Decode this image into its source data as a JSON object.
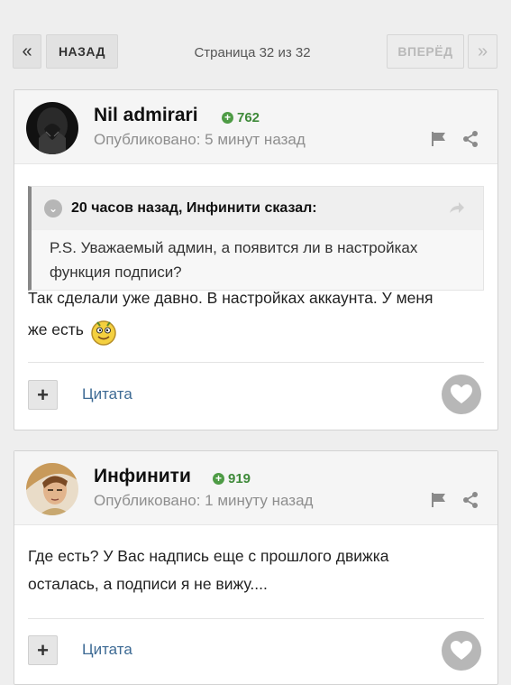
{
  "pagination": {
    "prev_arrow": "«",
    "prev_label": "НАЗАД",
    "page_info": "Страница 32 из 32",
    "next_label": "ВПЕРЁД",
    "next_arrow": "»"
  },
  "posts": [
    {
      "author": "Nil admirari",
      "reputation": "762",
      "posted": "Опубликовано: 5 минут назад",
      "quote": {
        "header": "20 часов назад, Инфинити сказал:",
        "text": "P.S. Уважаемый админ, а появится ли в настройках функция подписи?"
      },
      "text_line1": "Так сделали уже давно. В настройках аккаунта. У меня",
      "text_line2": "же есть",
      "emoji": "smiley-emoji",
      "quote_button": "Цитата"
    },
    {
      "author": "Инфинити",
      "reputation": "919",
      "posted": "Опубликовано: 1 минуту назад",
      "text_line1": "Где есть? У Вас надпись еще с прошлого движка",
      "text_line2": "осталась, а подписи я не вижу....",
      "quote_button": "Цитата"
    }
  ],
  "icons": {
    "report": "flag-icon",
    "share": "share-icon",
    "like": "heart-icon",
    "add": "plus-icon"
  },
  "colors": {
    "reputation": "#3f8a3a",
    "link": "#3d6a94",
    "like_button": "#b7b7b7"
  }
}
